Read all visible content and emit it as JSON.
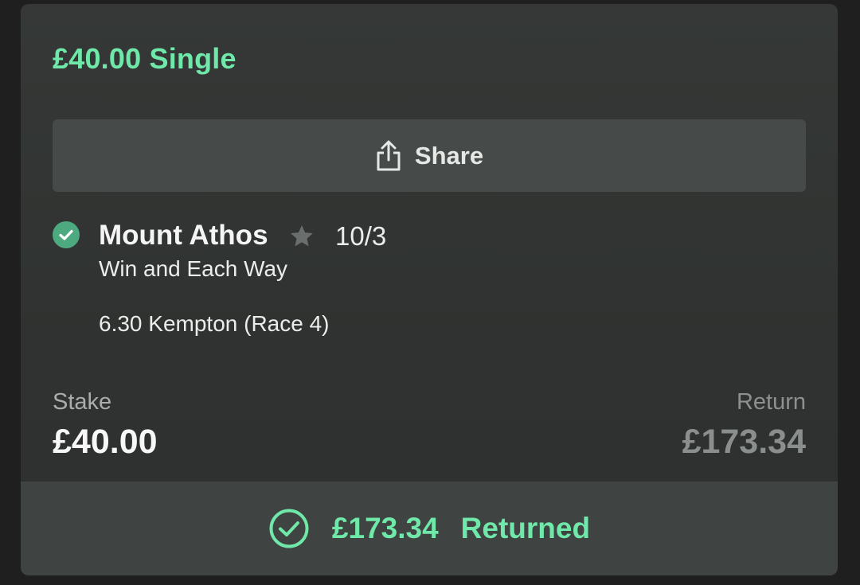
{
  "bet": {
    "title": "£40.00 Single"
  },
  "share": {
    "label": "Share",
    "icon": "share-icon"
  },
  "selection": {
    "status_icon": "check-circle-icon",
    "runner": "Mount Athos",
    "favourite_icon": "star-icon",
    "odds": "10/3",
    "market": "Win and Each Way",
    "event": "6.30 Kempton (Race 4)"
  },
  "stake": {
    "label": "Stake",
    "value": "£40.00"
  },
  "return": {
    "label": "Return",
    "value": "£173.34"
  },
  "result": {
    "icon": "check-circle-outline-icon",
    "amount": "£173.34",
    "status": "Returned"
  },
  "colors": {
    "accent_green": "#6fe8a9",
    "badge_green": "#4da97f",
    "card_background": "#353836",
    "button_background": "#464b49"
  }
}
